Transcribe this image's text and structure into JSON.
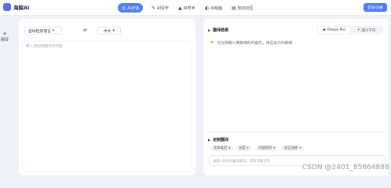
{
  "brand": {
    "name": "海鲸AI"
  },
  "nav": [
    {
      "label": "AI对话",
      "icon": "chat-icon",
      "active": true
    },
    {
      "label": "AI写作",
      "icon": "pen-icon",
      "active": false
    },
    {
      "label": "AI学术",
      "icon": "graduation-cap-icon",
      "active": false
    },
    {
      "label": "AI绘画",
      "icon": "palette-icon",
      "active": false
    },
    {
      "label": "知识社区",
      "icon": "book-icon",
      "active": false
    }
  ],
  "login_label": "登录/注册",
  "rail": {
    "icon": "translate-icon",
    "label": "翻译"
  },
  "source": {
    "from_lang": "自动检测语言",
    "to_lang": "中文",
    "placeholder": "输入/粘贴要翻译的内容"
  },
  "result": {
    "title": "翻译结果",
    "engines": [
      "DeepL-Pro",
      "通义千问"
    ],
    "hint": "在左侧输入要翻译的内容后，将自动为你翻译"
  },
  "custom": {
    "title": "定制翻译",
    "chips": [
      "文本类型",
      "长度",
      "内容结构",
      "语言风格"
    ],
    "placeholder": "请输入特别的翻译要求，或许可留空等"
  },
  "watermark": "CSDN @2401_85664888"
}
